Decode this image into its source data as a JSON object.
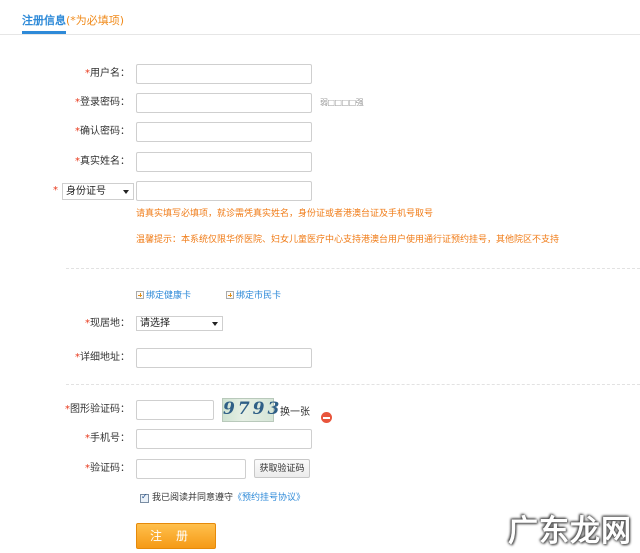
{
  "tab": {
    "title": "注册信息",
    "hint": "(*为必填项)"
  },
  "required_mark": "*",
  "fields": {
    "username": {
      "label": "用户名：",
      "value": ""
    },
    "password": {
      "label": "登录密码：",
      "value": "",
      "strength": "弱□□□□强"
    },
    "confirm_password": {
      "label": "确认密码：",
      "value": ""
    },
    "real_name": {
      "label": "真实姓名：",
      "value": ""
    },
    "id_type": {
      "selected": "身份证号",
      "value": ""
    },
    "residence": {
      "label": "现居地：",
      "selected": "请选择"
    },
    "address": {
      "label": "详细地址：",
      "value": ""
    },
    "captcha": {
      "label": "图形验证码：",
      "value": "",
      "image_text": "9793",
      "refresh": "换一张"
    },
    "phone": {
      "label": "手机号：",
      "value": ""
    },
    "sms_code": {
      "label": "验证码：",
      "value": "",
      "button": "获取验证码"
    }
  },
  "notices": {
    "line1": "请真实填写必填项，就诊需凭真实姓名，身份证或者港澳台证及手机号取号",
    "line2": "温馨提示：本系统仅限华侨医院、妇女儿童医疗中心支持港澳台用户使用通行证预约挂号，其他院区不支持"
  },
  "bind": {
    "health_card": "绑定健康卡",
    "citizen_card": "绑定市民卡"
  },
  "agreement": {
    "text": "我已阅读并同意遵守",
    "link": "《预约挂号协议》",
    "checked": true
  },
  "submit": {
    "label": "注册"
  },
  "watermark": "广东龙网",
  "colors": {
    "accent": "#2e8ad8",
    "warning": "#f07c18",
    "required": "#e8381b",
    "button": "#f59a16"
  }
}
